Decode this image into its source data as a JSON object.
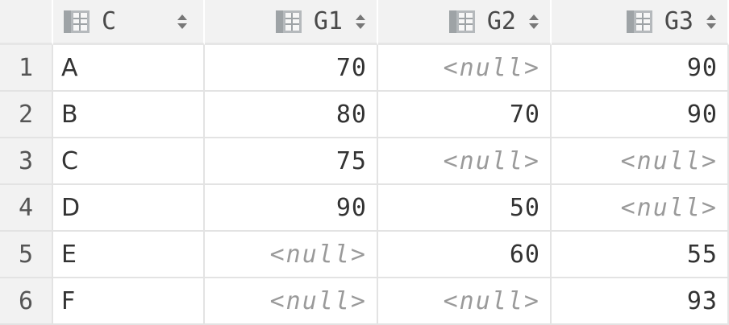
{
  "table": {
    "columns": [
      {
        "label": "C",
        "icon": "table-icon",
        "sort_icon": "sort-icon"
      },
      {
        "label": "G1",
        "icon": "table-icon",
        "sort_icon": "sort-icon"
      },
      {
        "label": "G2",
        "icon": "table-icon",
        "sort_icon": "sort-icon"
      },
      {
        "label": "G3",
        "icon": "table-icon",
        "sort_icon": "sort-icon"
      }
    ],
    "null_text": "<null>",
    "rows": [
      {
        "num": "1",
        "C": "A",
        "G1": "70",
        "G2": "<null>",
        "G3": "90"
      },
      {
        "num": "2",
        "C": "B",
        "G1": "80",
        "G2": "70",
        "G3": "90"
      },
      {
        "num": "3",
        "C": "C",
        "G1": "75",
        "G2": "<null>",
        "G3": "<null>"
      },
      {
        "num": "4",
        "C": "D",
        "G1": "90",
        "G2": "50",
        "G3": "<null>"
      },
      {
        "num": "5",
        "C": "E",
        "G1": "<null>",
        "G2": "60",
        "G3": "55"
      },
      {
        "num": "6",
        "C": "F",
        "G1": "<null>",
        "G2": "<null>",
        "G3": "93"
      }
    ]
  },
  "colors": {
    "header_bg": "#f2f2f2",
    "grid_line": "#e3e3e3",
    "null_text": "#9a9a9a",
    "icon_gray": "#9ea3a6"
  }
}
